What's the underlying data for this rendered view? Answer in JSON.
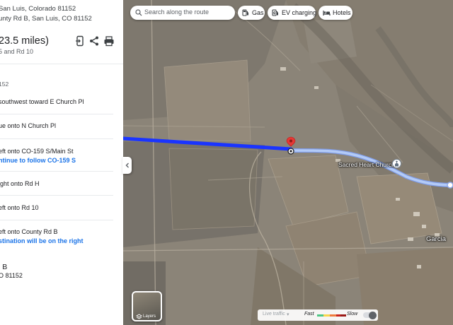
{
  "panel": {
    "start_line1": "San Luis, Colorado 81152",
    "start_line2": "unty Rd B, San Luis, CO 81152",
    "route_summary": "23.5 miles)",
    "via": "5 and Rd 10",
    "tools": {
      "send_icon": "send-to-phone-icon",
      "share_icon": "share-icon",
      "print_icon": "print-icon"
    },
    "start_zip": "152",
    "steps": [
      {
        "text": "southwest toward E Church Pl",
        "note": ""
      },
      {
        "text": "ue onto N Church Pl",
        "note": ""
      },
      {
        "text": "eft onto CO-159 S/Main St",
        "note": "ntinue to follow CO-159 S"
      },
      {
        "text": "ight onto Rd H",
        "note": ""
      },
      {
        "text": "eft onto Rd 10",
        "note": ""
      },
      {
        "text": "eft onto County Rd B",
        "note": "stination will be on the right"
      }
    ],
    "destination_name": "l B",
    "destination_zip": "O 81152"
  },
  "map": {
    "search_placeholder": "Search along the route",
    "chips": [
      {
        "label": "Gas",
        "icon": "gas-station-icon"
      },
      {
        "label": "EV charging",
        "icon": "ev-charging-icon"
      },
      {
        "label": "Hotels",
        "icon": "hotel-icon"
      }
    ],
    "places": {
      "church": "Sacred Heart Church",
      "town": "Garcia"
    },
    "layers_label": "Layers",
    "traffic": {
      "live_label": "Live traffic",
      "fast": "Fast",
      "slow": "Slow"
    }
  },
  "colors": {
    "route_traveled": "#1a34ff",
    "route_ahead": "#a9c4f5",
    "pin": "#e53935",
    "link": "#1a73e8",
    "traffic_scale": [
      "#4ec785",
      "#f7d74e",
      "#ef7b3e",
      "#c5221f",
      "#9a1a16"
    ]
  }
}
